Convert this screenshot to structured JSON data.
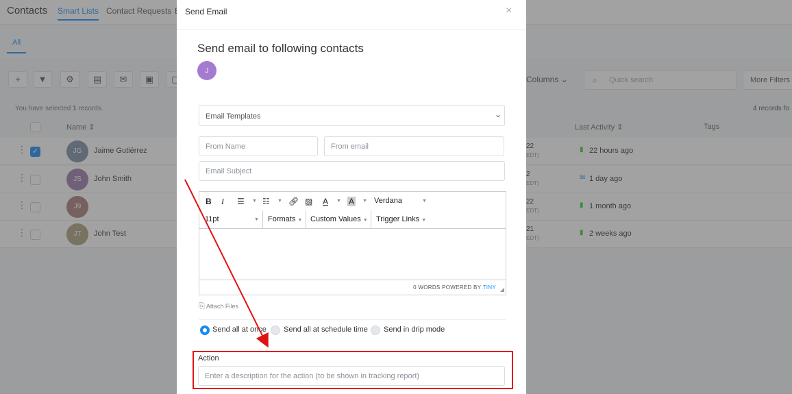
{
  "app": {
    "title": "Contacts",
    "tabs": [
      "Smart Lists",
      "Contact Requests",
      "B"
    ],
    "sub_tab": "All",
    "columns_label": "Columns",
    "search_placeholder": "Quick search",
    "more_filters": "More Filters",
    "selected_prefix": "You have selected ",
    "selected_count": "1",
    "selected_suffix": " records.",
    "records_count": "4 records fo",
    "headers": {
      "name": "Name",
      "last_activity": "Last Activity",
      "tags": "Tags"
    },
    "rows": [
      {
        "initials": "JG",
        "name": "Jaime Gutiérrez",
        "date": "22",
        "date_sub": "EDT)",
        "activity": "22 hours ago",
        "checked": true,
        "avatar_color": "#7a8fa8",
        "activity_icon": "chat"
      },
      {
        "initials": "JS",
        "name": "John Smith",
        "date": "2",
        "date_sub": "EDT)",
        "activity": "1 day ago",
        "checked": false,
        "avatar_color": "#9b7aa8",
        "activity_icon": "mail"
      },
      {
        "initials": "J9",
        "name": "",
        "date": "22",
        "date_sub": "EDT)",
        "activity": "1 month ago",
        "checked": false,
        "avatar_color": "#a87a7a",
        "activity_icon": "chat"
      },
      {
        "initials": "JT",
        "name": "John Test",
        "date": "21",
        "date_sub": "EDT)",
        "activity": "2 weeks ago",
        "checked": false,
        "avatar_color": "#a8a07a",
        "activity_icon": "chat"
      }
    ]
  },
  "modal": {
    "title": "Send Email",
    "heading": "Send email to following contacts",
    "contact_initial": "J",
    "templates": "Email Templates",
    "from_name": "From Name",
    "from_email": "From email",
    "subject": "Email Subject",
    "editor": {
      "font": "Verdana",
      "size": "11pt",
      "formats": "Formats",
      "custom_values": "Custom Values",
      "trigger_links": "Trigger Links",
      "status": "0 WORDS POWERED BY",
      "brand": "TINY"
    },
    "attach": "Attach Files",
    "send_options": [
      "Send all at once",
      "Send all at schedule time",
      "Send in drip mode"
    ],
    "action_label": "Action",
    "action_placeholder": "Enter a description for the action (to be shown in tracking report)"
  },
  "colors": {
    "accent": "#188bf6",
    "highlight": "#e01313",
    "avatar": "#a57bd0"
  }
}
